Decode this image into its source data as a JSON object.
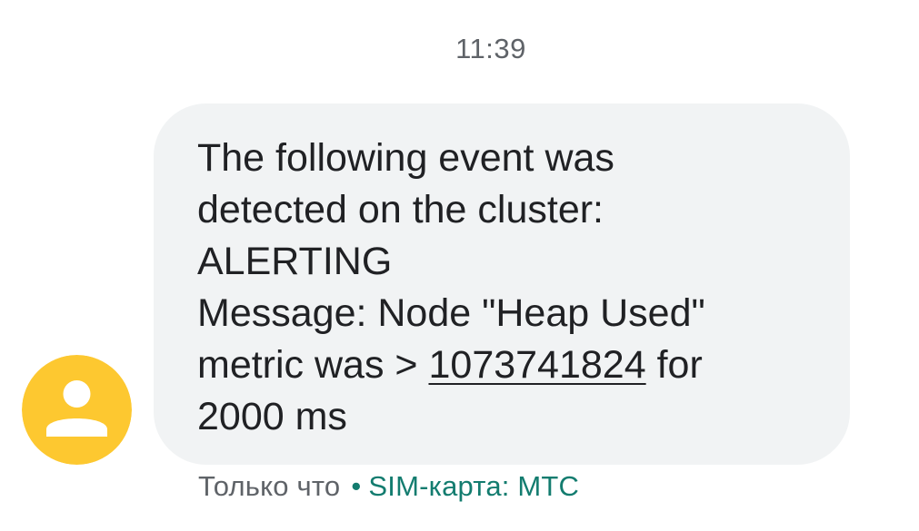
{
  "conversation": {
    "timestamp": "11:39"
  },
  "sender": {
    "avatar_icon": "person-icon",
    "avatar_color": "#FDC830"
  },
  "message": {
    "line1": "The following event was",
    "line2": "detected on the cluster:",
    "line3": "ALERTING",
    "line4": "Message: Node \"Heap Used\"",
    "line5_prefix": "metric was > ",
    "line5_number": "1073741824",
    "line5_suffix": " for",
    "line6": "2000 ms"
  },
  "meta": {
    "time": "Только что",
    "separator": "•",
    "sim": "SIM-карта: МТС",
    "sim_color": "#137C6F"
  },
  "colors": {
    "bubble_bg": "#F1F3F4",
    "text": "#202124",
    "secondary_text": "#5F6368"
  }
}
